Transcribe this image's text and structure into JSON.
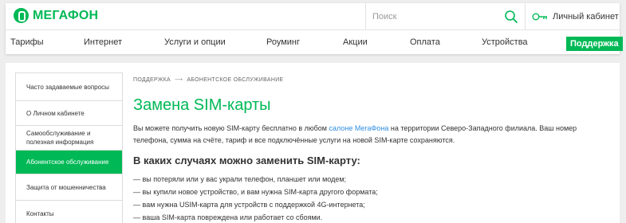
{
  "brand": {
    "logo_text": "МЕГАФОН",
    "accent": "#00b956"
  },
  "search": {
    "placeholder": "Поиск",
    "icon": "search-icon"
  },
  "account": {
    "label": "Личный кабинет",
    "icon": "key-icon"
  },
  "nav": {
    "items": [
      "Тарифы",
      "Интернет",
      "Услуги и опции",
      "Роуминг",
      "Акции",
      "Оплата",
      "Устройства"
    ],
    "support_label": "Поддержка"
  },
  "sidebar": {
    "items": [
      {
        "label": "Часто задаваемые вопросы",
        "active": false
      },
      {
        "label": "О Личном кабинете",
        "active": false
      },
      {
        "label": "Самообслуживание и полезная информация",
        "active": false
      },
      {
        "label": "Абонентское обслуживание",
        "active": true
      },
      {
        "label": "Защита от мошенничества",
        "active": false
      },
      {
        "label": "Контакты",
        "active": false
      }
    ]
  },
  "breadcrumb": {
    "items": [
      "ПОДДЕРЖКА",
      "АБОНЕНТСКОЕ ОБСЛУЖИВАНИЕ"
    ],
    "separator": "⟶"
  },
  "page": {
    "title": "Замена SIM-карты",
    "intro_before": "Вы можете получить новую SIM-карту бесплатно в любом ",
    "intro_link": "салоне МегаФона",
    "intro_after": " на территории Северо-Западного филиала. Ваш номер телефона, сумма на счёте, тариф и все подключённые услуги на новой SIM-карте сохраняются.",
    "subheading": "В каких случаях можно заменить SIM-карту:",
    "bullets": [
      "вы потеряли или у вас украли телефон, планшет или модем;",
      "вы купили новое устройство, и вам нужна SIM-карта другого формата;",
      "вам нужна USIM-карта для устройств с поддержкой 4G-интернета;",
      "ваша SIM-карта повреждена или работает со сбоями."
    ]
  }
}
